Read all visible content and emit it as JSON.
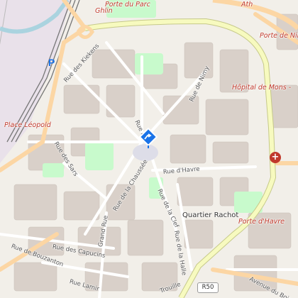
{
  "map": {
    "labels": {
      "porte_du_parc": "Porte du Parc",
      "ghlin": "Ghlin",
      "ath": "Ath",
      "porte_de_nimy": "Porte de Nim",
      "rue_des_kiekens": "Rue des Kiekens",
      "rue_de_nimy": "Rue de Nimy",
      "hopital_de_mons": "Hôpital de Mons -",
      "rue_neuve": "Rue Neu",
      "place_leopold": "Place Léopold",
      "rue_des_sars": "Rue des Sars",
      "rue_de_havre": "Rue d'Havre",
      "rue_de_la_chaussee": "Rue de la Chaussée",
      "rue_de_la_clef": "Rue de la Clef",
      "quartier_rachot": "Quartier Rachot",
      "porte_de_havre": "Porte d'Havre",
      "grand_rue": "Grand Rue",
      "rue_de_la_halle": "Rue de la Halle",
      "rue_des_capucins": "Rue des Capucins",
      "rue_de_bouzanton": "Rue de Bouzanton",
      "rue_lamir": "Rue Lamir",
      "avenue_du_bois": "Avenue du Bois",
      "trouille": "Trouille",
      "r50": "R50",
      "parking": "P",
      "hospital_symbol": "+"
    },
    "icons": {
      "marker": "location-pin-icon",
      "parking": "parking-icon",
      "hospital": "hospital-icon"
    },
    "colors": {
      "land": "#f2efe9",
      "blocks": "#d9d0c9",
      "ring_road": "#f7fabf",
      "ring_outline": "#c6c98a",
      "major_road": "#fcd6a4",
      "park": "#c8facc",
      "railway_area": "#e9e1ea",
      "marker": "#1a73e8",
      "label_red": "#c0392b"
    }
  }
}
